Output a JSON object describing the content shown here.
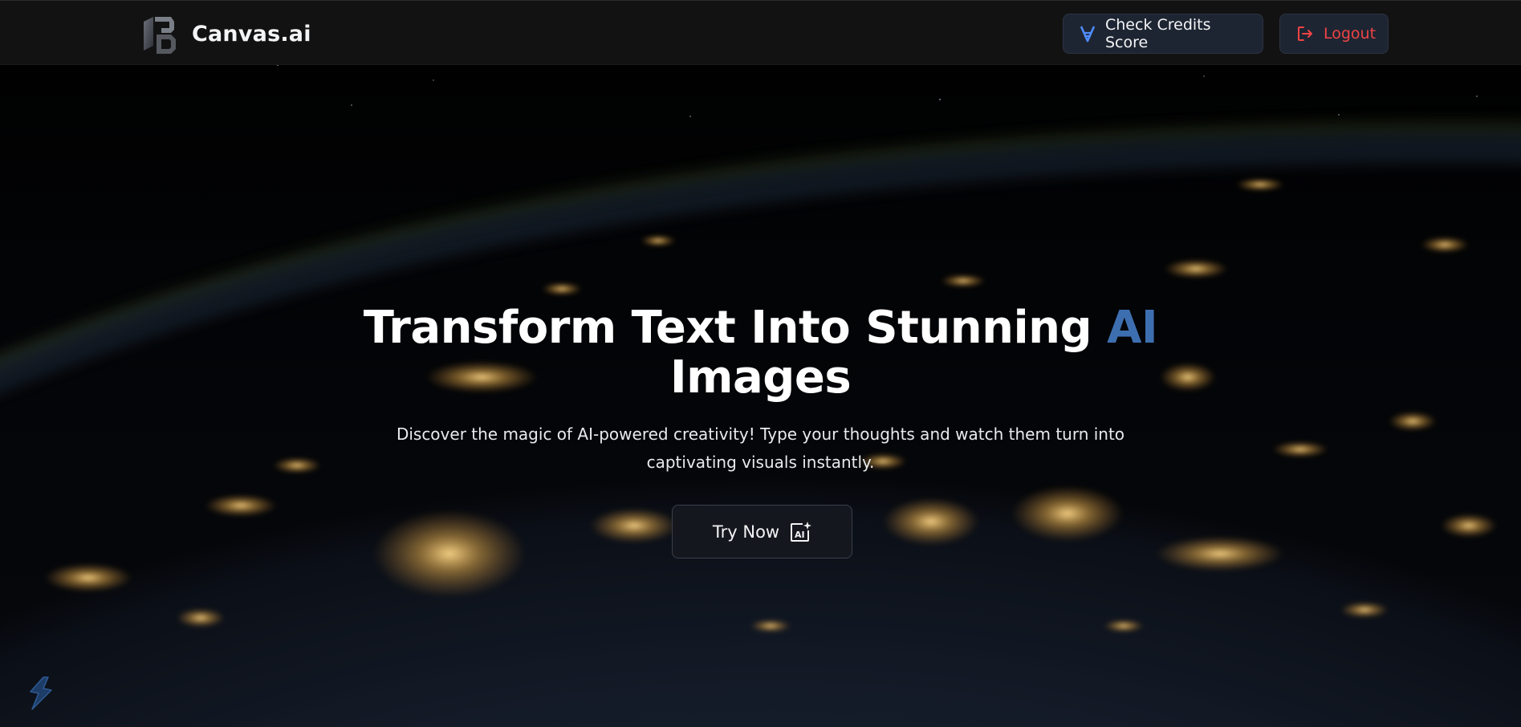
{
  "header": {
    "brand": "Canvas.ai",
    "credits_label": "Check Credits Score",
    "logout_label": "Logout"
  },
  "hero": {
    "title_main": "Transform Text Into Stunning ",
    "title_accent": "AI",
    "title_end": "Images",
    "subtitle": "Discover the magic of AI-powered creativity! Type your thoughts and watch them turn into captivating visuals instantly.",
    "cta_label": "Try Now"
  },
  "colors": {
    "header_bg": "#121212",
    "button_bg": "#1e2532",
    "accent_blue": "#3d6fb0",
    "logout_red": "#ef4444"
  },
  "icons": {
    "brand_logo": "canvas-logo-icon",
    "credits": "v-credits-icon",
    "logout": "logout-icon",
    "cta": "ai-sparkle-icon",
    "corner": "bolt-widget-icon"
  }
}
